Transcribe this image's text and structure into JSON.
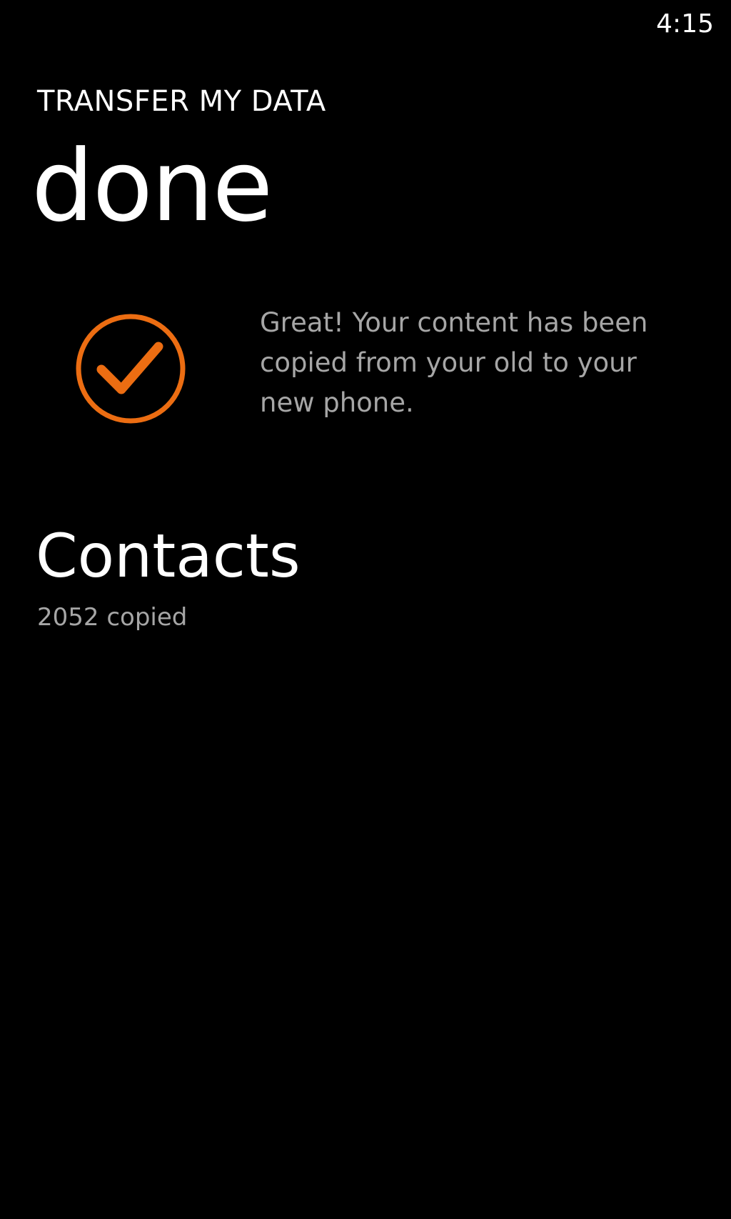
{
  "status_bar": {
    "time": "4:15"
  },
  "header": {
    "app_title": "TRANSFER MY DATA",
    "page_title": "done"
  },
  "result": {
    "icon": "check-circle-icon",
    "accent_color": "#ec6d12",
    "message": "Great! Your content has been copied from your old to your new phone."
  },
  "summary": {
    "category": "Contacts",
    "detail": "2052 copied"
  }
}
